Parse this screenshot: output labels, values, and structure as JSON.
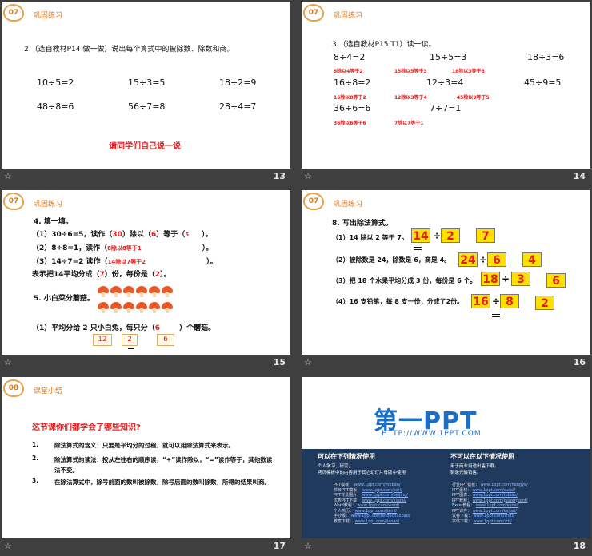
{
  "slide13": {
    "badge": "07",
    "section": "巩固练习",
    "question": "2.（选自教材P14 做一做）说出每个算式中的被除数、除数和商。",
    "equations": [
      "10÷5=2",
      "15÷3=5",
      "18÷2=9",
      "48÷8=6",
      "56÷7=8",
      "28÷4=7"
    ],
    "prompt": "请同学们自己说一说",
    "page": "13"
  },
  "slide14": {
    "badge": "07",
    "section": "巩固练习",
    "question": "3.（选自教材P15 T1）读一读。",
    "rows": [
      {
        "eq": [
          "8÷4=2",
          "15÷5=3",
          "18÷3=6"
        ],
        "read": [
          "8除以4等于2",
          "15除以5等于3",
          "18除以3等于6"
        ]
      },
      {
        "eq": [
          "16÷8=2",
          "12÷3=4",
          "45÷9=5"
        ],
        "read": [
          "16除以8等于2",
          "12除以3等于4",
          "45除以9等于5"
        ]
      },
      {
        "eq": [
          "36÷6=6",
          "7÷7=1"
        ],
        "read": [
          "36除以6等于6",
          "7除以7等于1"
        ]
      }
    ],
    "page": "14"
  },
  "slide15": {
    "badge": "07",
    "section": "巩固练习",
    "q4": "4. 填一填。",
    "line1_a": "（1）30÷6=5，读作（",
    "line1_v1": "30",
    "line1_b": "）除以（",
    "line1_v2": "6",
    "line1_c": "）等于（",
    "line1_v3": "5",
    "line1_d": "）。",
    "line2_a": "（2）8÷8=1，读作（",
    "line2_v": "8除以8等于1",
    "line2_b": "）。",
    "line3_a": "（3）14÷7=2 读作（",
    "line3_v": "14除以7等于2",
    "line3_b": "）。",
    "line4_a": "表示把14平均分成（",
    "line4_v1": "7",
    "line4_b": "）份，每份是（",
    "line4_v2": "2",
    "line4_c": "）。",
    "q5": "5. 小白菜分蘑菇。",
    "q5_sub_a": "（1）平均分给 2 只小白兔，每只分（",
    "q5_sub_v": "6",
    "q5_sub_b": "）个蘑菇。",
    "boxes": [
      "12",
      "2",
      "6"
    ],
    "page": "15"
  },
  "slide16": {
    "badge": "07",
    "section": "巩固练习",
    "question": "8. 写出除法算式。",
    "items": [
      {
        "text": "（1）14 除以 2 等于 7。",
        "a": "14",
        "b": "2",
        "c": "7"
      },
      {
        "text": "（2）被除数是 24，除数是 6，商是 4。",
        "a": "24",
        "b": "6",
        "c": "4"
      },
      {
        "text": "（3）把 18 个水果平均分成 3 份，每份是 6 个。",
        "a": "18",
        "b": "3",
        "c": "6"
      },
      {
        "text": "（4）16 支铅笔，每 8 支一份，分成了2份。",
        "a": "16",
        "b": "8",
        "c": "2"
      }
    ],
    "page": "16"
  },
  "slide17": {
    "badge": "08",
    "section": "课堂小结",
    "heading": "这节课你们都学会了哪些知识?",
    "points": [
      {
        "n": "1.",
        "text": "除法算式的含义：只要是平均分的过程，就可以用除法算式来表示。"
      },
      {
        "n": "2.",
        "text": "除法算式的读法：按从左往右的顺序读，“÷”读作除以，“=”读作等于，其他数读法不变。"
      },
      {
        "n": "3.",
        "text": "在除法算式中，除号前面的数叫被除数，除号后面的数叫除数，所得的结果叫商。"
      }
    ],
    "page": "17"
  },
  "slide18": {
    "logo": "第一PPT",
    "url": "HTTP://WWW.1PPT.COM",
    "col1_title": "可以在下列情况使用",
    "col1_items": [
      "个人学习、研究。",
      "拷贝模板中的内容用于其它幻灯片母版中使用"
    ],
    "col2_title": "不可以在以下情况使用",
    "col2_items": [
      "用于商业用途出售下载。",
      "刻录光碟销售。"
    ],
    "links_left": [
      [
        "PPT模板：",
        "www.1ppt.com/moban/"
      ],
      [
        "节日PPT模板：",
        "www.1ppt.com/jieri/"
      ],
      [
        "PPT背景图片：",
        "www.1ppt.com/beijing/"
      ],
      [
        "优秀PPT下载：",
        "www.1ppt.com/xiazai/"
      ],
      [
        "Word教程：",
        "www.1ppt.com/word/"
      ],
      [
        "个人简历：",
        "www.1ppt.com/jianli/"
      ],
      [
        "手抄报：",
        "www.1ppt.com/shouchaobao/"
      ],
      [
        "教案下载：",
        "www.1ppt.com/jiaoan/"
      ]
    ],
    "links_right": [
      [
        "行业PPT模板：",
        "www.1ppt.com/hangye/"
      ],
      [
        "PPT素材：",
        "www.1ppt.com/sucai/"
      ],
      [
        "PPT图表：",
        "www.1ppt.com/tubiao/"
      ],
      [
        "PPT教程：",
        "www.1ppt.com/powerpoint/"
      ],
      [
        "Excel教程：",
        "www.1ppt.com/excel/"
      ],
      [
        "PPT课件：",
        "www.1ppt.com/kejian/"
      ],
      [
        "试卷下载：",
        "www.1ppt.com/shiti/"
      ],
      [
        "字体下载：",
        "www.1ppt.com/ziti/"
      ]
    ],
    "page": "18"
  },
  "colors": {
    "accent": "#e07b1b",
    "red": "#e02020",
    "yellow": "#ffe000",
    "navy": "#1f3a5c",
    "brand": "#1a70c8"
  }
}
